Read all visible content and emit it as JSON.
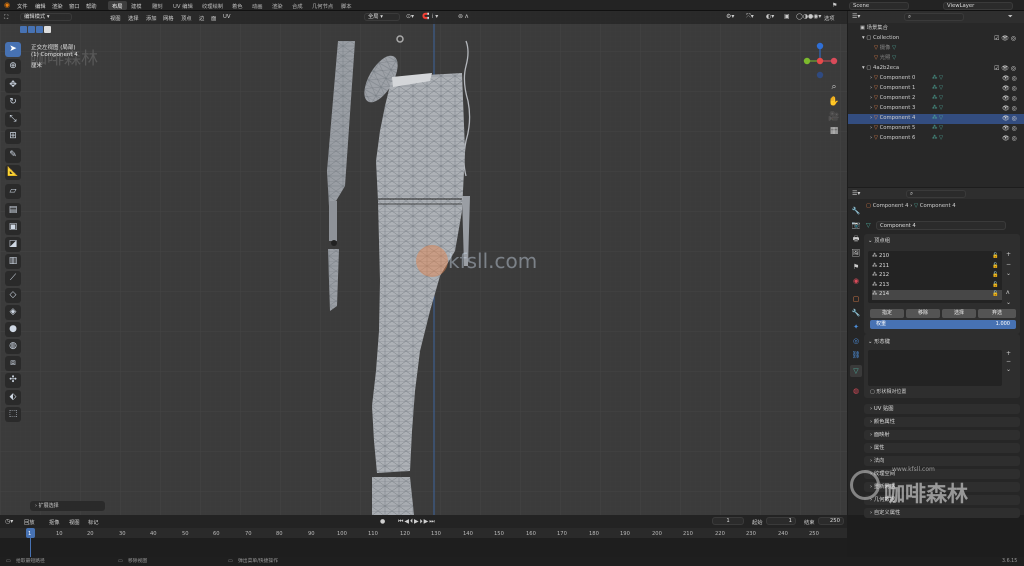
{
  "topbar": {
    "menus": [
      "文件",
      "编辑",
      "渲染",
      "窗口",
      "帮助"
    ],
    "workspaces": [
      "布局",
      "建模",
      "雕刻",
      "UV 编辑",
      "纹理绘制",
      "着色",
      "动画",
      "渲染",
      "合成",
      "几何节点",
      "脚本"
    ],
    "active_workspace": "布局",
    "scene": "Scene",
    "view_layer": "ViewLayer"
  },
  "viewport": {
    "mode": "编辑模式",
    "menus": [
      "视图",
      "选择",
      "添加",
      "网格",
      "顶点",
      "边",
      "面",
      "UV"
    ],
    "transform_orientation": "全局",
    "options_label": "选项",
    "overlay_title": "正交左视图 (局部)",
    "overlay_object": "(1) Component 4",
    "overlay_units": "厘米",
    "watermark_site": "kfsll.com",
    "watermark_brand": "咖啡森林",
    "watermark_url": "www.kfsll.com",
    "last_operator": "扩展选择"
  },
  "outliner": {
    "root": "场景集合",
    "items": [
      {
        "name": "Collection",
        "depth": 0,
        "selected": false
      },
      {
        "name": "摄像",
        "depth": 1,
        "selected": false
      },
      {
        "name": "光照",
        "depth": 1,
        "selected": false
      },
      {
        "name": "4a2b2eca",
        "depth": 0,
        "selected": false
      },
      {
        "name": "Component 0",
        "depth": 1,
        "selected": false
      },
      {
        "name": "Component 1",
        "depth": 1,
        "selected": false
      },
      {
        "name": "Component 2",
        "depth": 1,
        "selected": false
      },
      {
        "name": "Component 3",
        "depth": 1,
        "selected": false
      },
      {
        "name": "Component 4",
        "depth": 1,
        "selected": true
      },
      {
        "name": "Component 5",
        "depth": 1,
        "selected": false
      },
      {
        "name": "Component 6",
        "depth": 1,
        "selected": false
      }
    ]
  },
  "properties": {
    "breadcrumb_object": "Component 4",
    "breadcrumb_mesh": "Component 4",
    "mesh_name": "Component 4",
    "vertex_groups_title": "顶点组",
    "vertex_groups": [
      "210",
      "211",
      "212",
      "213",
      "214"
    ],
    "active_vertex_group": "214",
    "buttons": {
      "assign": "指定",
      "remove": "移除",
      "select": "选择",
      "deselect": "弃选"
    },
    "weight_label": "权重",
    "weight_value": "1.000",
    "shape_keys_title": "形态键",
    "relative_label": "形状相对位置",
    "sections": [
      "UV 贴图",
      "颜色属性",
      "面映射",
      "属性",
      "法向",
      "纹理空间",
      "重新网格",
      "几何数据",
      "自定义属性"
    ]
  },
  "timeline": {
    "menus": [
      "回放",
      "抠像",
      "视图",
      "标记"
    ],
    "current_frame": "1",
    "start_label": "起始",
    "start": "1",
    "end_label": "结束",
    "end": "250",
    "ruler": [
      "1",
      "10",
      "20",
      "30",
      "40",
      "50",
      "60",
      "70",
      "80",
      "90",
      "100",
      "110",
      "120",
      "130",
      "140",
      "150",
      "160",
      "170",
      "180",
      "190",
      "200",
      "210",
      "220",
      "230",
      "240",
      "250"
    ]
  },
  "status": {
    "left": "拾取最短路径",
    "mid": "移除视图",
    "right": "弹出菜单/快捷操作",
    "version": "3.6.15"
  },
  "colors": {
    "accent": "#4772b3",
    "selected_row": "#334d80",
    "viewport_bg": "#3b3b3b",
    "mesh_triangle": "#7a7f86"
  }
}
